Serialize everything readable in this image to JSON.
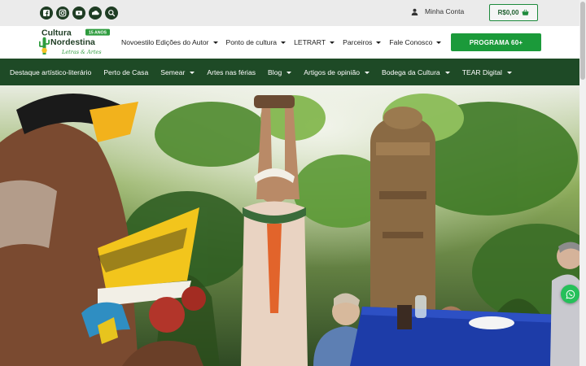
{
  "colors": {
    "dark_green": "#1e4a26",
    "accent_green": "#1b9a3a",
    "topbar_bg": "#ebebeb",
    "whatsapp_green": "#25c05a"
  },
  "topbar": {
    "social_icons": [
      "facebook-icon",
      "instagram-icon",
      "youtube-icon",
      "soundcloud-icon",
      "search-icon"
    ],
    "account_label": "Minha Conta",
    "cart_total": "R$0,00"
  },
  "logo": {
    "line1": "Cultura",
    "line2": "Nordestina",
    "badge": "15 ANOS",
    "tagline": "Letras & Artes"
  },
  "main_nav": [
    {
      "label": "Novoestilo Edições do Autor",
      "dropdown": true
    },
    {
      "label": "Ponto de cultura",
      "dropdown": true
    },
    {
      "label": "LETRART",
      "dropdown": true
    },
    {
      "label": "Parceiros",
      "dropdown": true
    },
    {
      "label": "Fale Conosco",
      "dropdown": true
    }
  ],
  "cta_label": "PROGRAMA 60+",
  "sub_nav": [
    {
      "label": "Destaque artístico-literário",
      "dropdown": false
    },
    {
      "label": "Perto de Casa",
      "dropdown": false
    },
    {
      "label": "Semear",
      "dropdown": true
    },
    {
      "label": "Artes nas férias",
      "dropdown": false
    },
    {
      "label": "Blog",
      "dropdown": true
    },
    {
      "label": "Artigos de opinião",
      "dropdown": true
    },
    {
      "label": "Bodega da Cultura",
      "dropdown": true
    },
    {
      "label": "TEAR Digital",
      "dropdown": true
    }
  ]
}
